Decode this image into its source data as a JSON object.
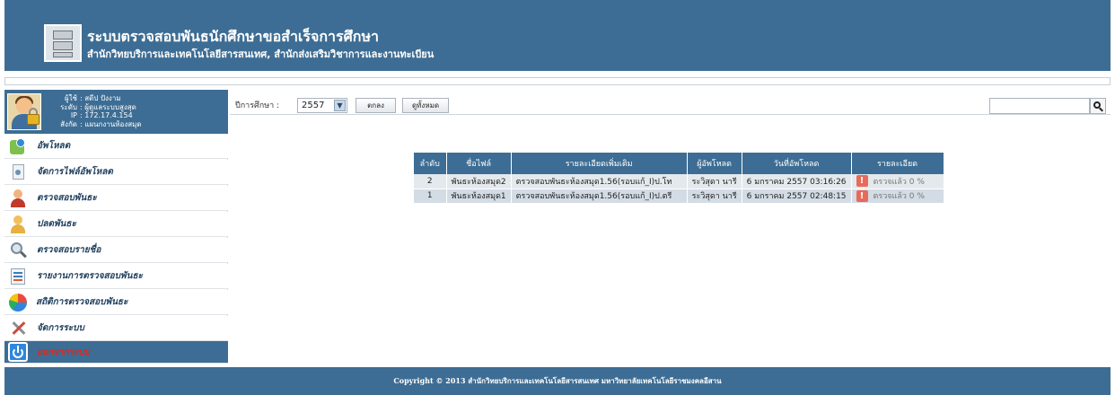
{
  "header": {
    "title": "ระบบตรวจสอบพันธนักศึกษาขอสำเร็จการศึกษา",
    "subtitle": "สำนักวิทยบริการและเทคโนโลยีสารสนเทศ, สำนักส่งเสริมวิชาการและงานทะเบียน",
    "logo_icon": "file-cabinet-icon"
  },
  "user": {
    "labels": [
      "ผู้ใช้",
      "ระดับ",
      "IP",
      "สังกัด"
    ],
    "values": [
      "สดีป ปังงาม",
      "ผู้ดูแลระบบสูงสุด",
      "172.17.4.154",
      "แผนกงานห้องสมุด"
    ]
  },
  "sidebar": {
    "items": [
      {
        "label": "อัพโหลด",
        "icon": "upload-icon"
      },
      {
        "label": "จัดการไฟล์อัพโหลด",
        "icon": "file-icon"
      },
      {
        "label": "ตรวจสอบพันธะ",
        "icon": "user-check-icon"
      },
      {
        "label": "ปลดพันธะ",
        "icon": "user-release-icon"
      },
      {
        "label": "ตรวจสอบรายชื่อ",
        "icon": "search-icon"
      },
      {
        "label": "รายงานการตรวจสอบพันธะ",
        "icon": "report-icon"
      },
      {
        "label": "สถิติการตรวจสอบพันธะ",
        "icon": "pie-chart-icon"
      },
      {
        "label": "จัดการระบบ",
        "icon": "tools-icon"
      },
      {
        "label": "ออกจากระบบ",
        "icon": "power-icon"
      }
    ]
  },
  "filter": {
    "year_label": "ปีการศึกษา :",
    "year_value": "2557",
    "ok_label": "ตกลง",
    "all_label": "ดูทั้งหมด",
    "search_value": ""
  },
  "table": {
    "headers": [
      "ลำดับ",
      "ชื่อไฟล์",
      "รายละเอียดเพิ่มเติม",
      "ผู้อัพโหลด",
      "วันที่อัพโหลด",
      "รายละเอียด"
    ],
    "rows": [
      {
        "no": "2",
        "file": "พันธะห้องสมุด2",
        "desc": "ตรวจสอบพันธะห้องสมุด1.56(รอบแก้_I)ป.โท",
        "uploader": "ระวิสุดา นารี",
        "date": "6 มกราคม 2557 03:16:26",
        "alert": "!",
        "status": "ตรวจแล้ว 0 %"
      },
      {
        "no": "1",
        "file": "พันธะห้องสมุด1",
        "desc": "ตรวจสอบพันธะห้องสมุด1.56(รอบแก้_I)ป.ตรี",
        "uploader": "ระวิสุดา นารี",
        "date": "6 มกราคม 2557 02:48:15",
        "alert": "!",
        "status": "ตรวจแล้ว 0 %"
      }
    ]
  },
  "footer": {
    "text": "Copyright © 2013 สำนักวิทยบริการและเทคโนโลยีสารสนเทศ มหาวิทยาลัยเทคโนโลยีราชมงคลอีสาน"
  },
  "colors": {
    "primary": "#3d6d94",
    "logout_text": "#e0261b",
    "alert": "#e86a5a"
  }
}
